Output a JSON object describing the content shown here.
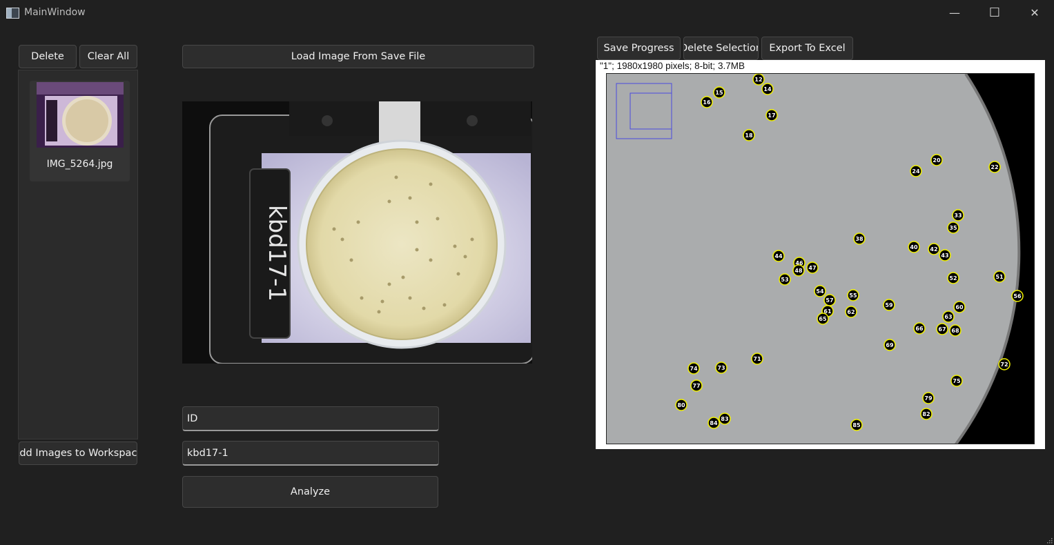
{
  "window": {
    "title": "MainWindow",
    "controls": {
      "minimize": "—",
      "maximize": "☐",
      "close": "✕"
    }
  },
  "left_panel": {
    "delete_label": "Delete",
    "clear_all_label": "Clear All",
    "items": [
      {
        "label": "IMG_5264.jpg"
      }
    ],
    "add_images_label": "Add Images to Workspace"
  },
  "center": {
    "load_label": "Load Image From Save File",
    "id_field_value": "ID",
    "name_field_value": "kbd17-1",
    "analyze_label": "Analyze",
    "plate_label_text": "kbd17-1"
  },
  "right": {
    "save_progress_label": "Save Progress",
    "delete_selection_label": "Delete Selection",
    "export_label": "Export To Excel",
    "image_info": "\"1\"; 1980x1980 pixels; 8-bit; 3.7MB",
    "markers": [
      "12",
      "14",
      "15",
      "16",
      "17",
      "18",
      "20",
      "22",
      "24",
      "33",
      "35",
      "38",
      "40",
      "42",
      "43",
      "44",
      "46",
      "47",
      "48",
      "51",
      "52",
      "53",
      "54",
      "55",
      "56",
      "57",
      "59",
      "60",
      "61",
      "62",
      "63",
      "65",
      "66",
      "67",
      "68",
      "69",
      "71",
      "72",
      "73",
      "74",
      "75",
      "77",
      "79",
      "80",
      "82",
      "83",
      "84",
      "85"
    ]
  },
  "colors": {
    "background": "#202020",
    "button": "#2d2d2d",
    "marker_ring": "#f0f000"
  }
}
